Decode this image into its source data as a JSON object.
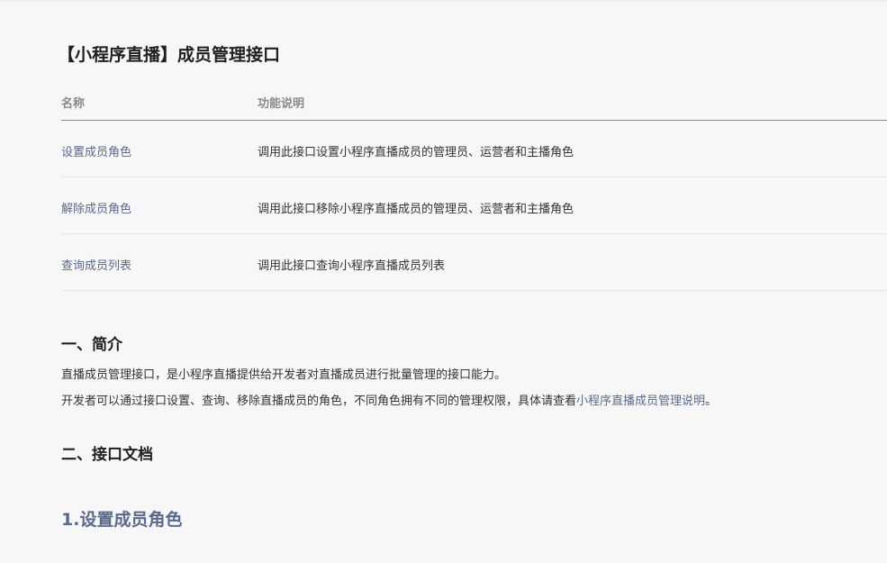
{
  "title": "【小程序直播】成员管理接口",
  "table": {
    "headers": {
      "name": "名称",
      "desc": "功能说明"
    },
    "rows": [
      {
        "name": "设置成员角色",
        "desc": "调用此接口设置小程序直播成员的管理员、运营者和主播角色"
      },
      {
        "name": "解除成员角色",
        "desc": "调用此接口移除小程序直播成员的管理员、运营者和主播角色"
      },
      {
        "name": "查询成员列表",
        "desc": "调用此接口查询小程序直播成员列表"
      }
    ]
  },
  "intro": {
    "heading": "一、简介",
    "line1": "直播成员管理接口，是小程序直播提供给开发者对直播成员进行批量管理的接口能力。",
    "line2_prefix": "开发者可以通过接口设置、查询、移除直播成员的角色，不同角色拥有不同的管理权限，具体请查看",
    "line2_link": "小程序直播成员管理说明",
    "line2_suffix": "。"
  },
  "docs": {
    "heading": "二、接口文档",
    "subheading": "1.设置成员角色"
  },
  "colors": {
    "link": "#5a6a8c",
    "background": "#f7f7f8"
  }
}
